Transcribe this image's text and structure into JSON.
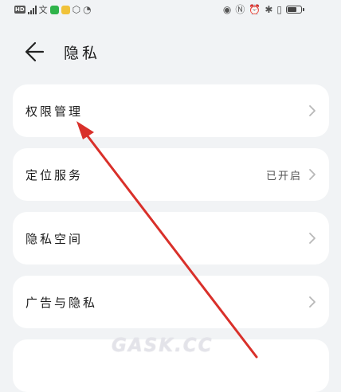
{
  "status_bar": {
    "hd": "HD",
    "text_icon": "文",
    "icons": [
      "hd-icon",
      "signal-icon",
      "text-icon",
      "wechat-icon",
      "app-icon",
      "gallery-icon",
      "sync-icon",
      "eye-icon",
      "nfc-icon",
      "alarm-icon",
      "bluetooth-icon",
      "vibrate-icon",
      "battery-icon"
    ],
    "colors": {
      "wechat": "#2fb34a",
      "app": "#f0c239"
    }
  },
  "header": {
    "title": "隐私",
    "back_icon": "back-arrow-icon"
  },
  "items": [
    {
      "label": "权限管理",
      "value": ""
    },
    {
      "label": "定位服务",
      "value": "已开启"
    },
    {
      "label": "隐私空间",
      "value": ""
    },
    {
      "label": "广告与隐私",
      "value": ""
    }
  ],
  "overlay": {
    "watermark": "GASK.CC",
    "arrow_color": "#d9302a"
  },
  "colors": {
    "background": "#f1f3f5",
    "card": "#ffffff",
    "chevron": "#b8b8b8"
  }
}
